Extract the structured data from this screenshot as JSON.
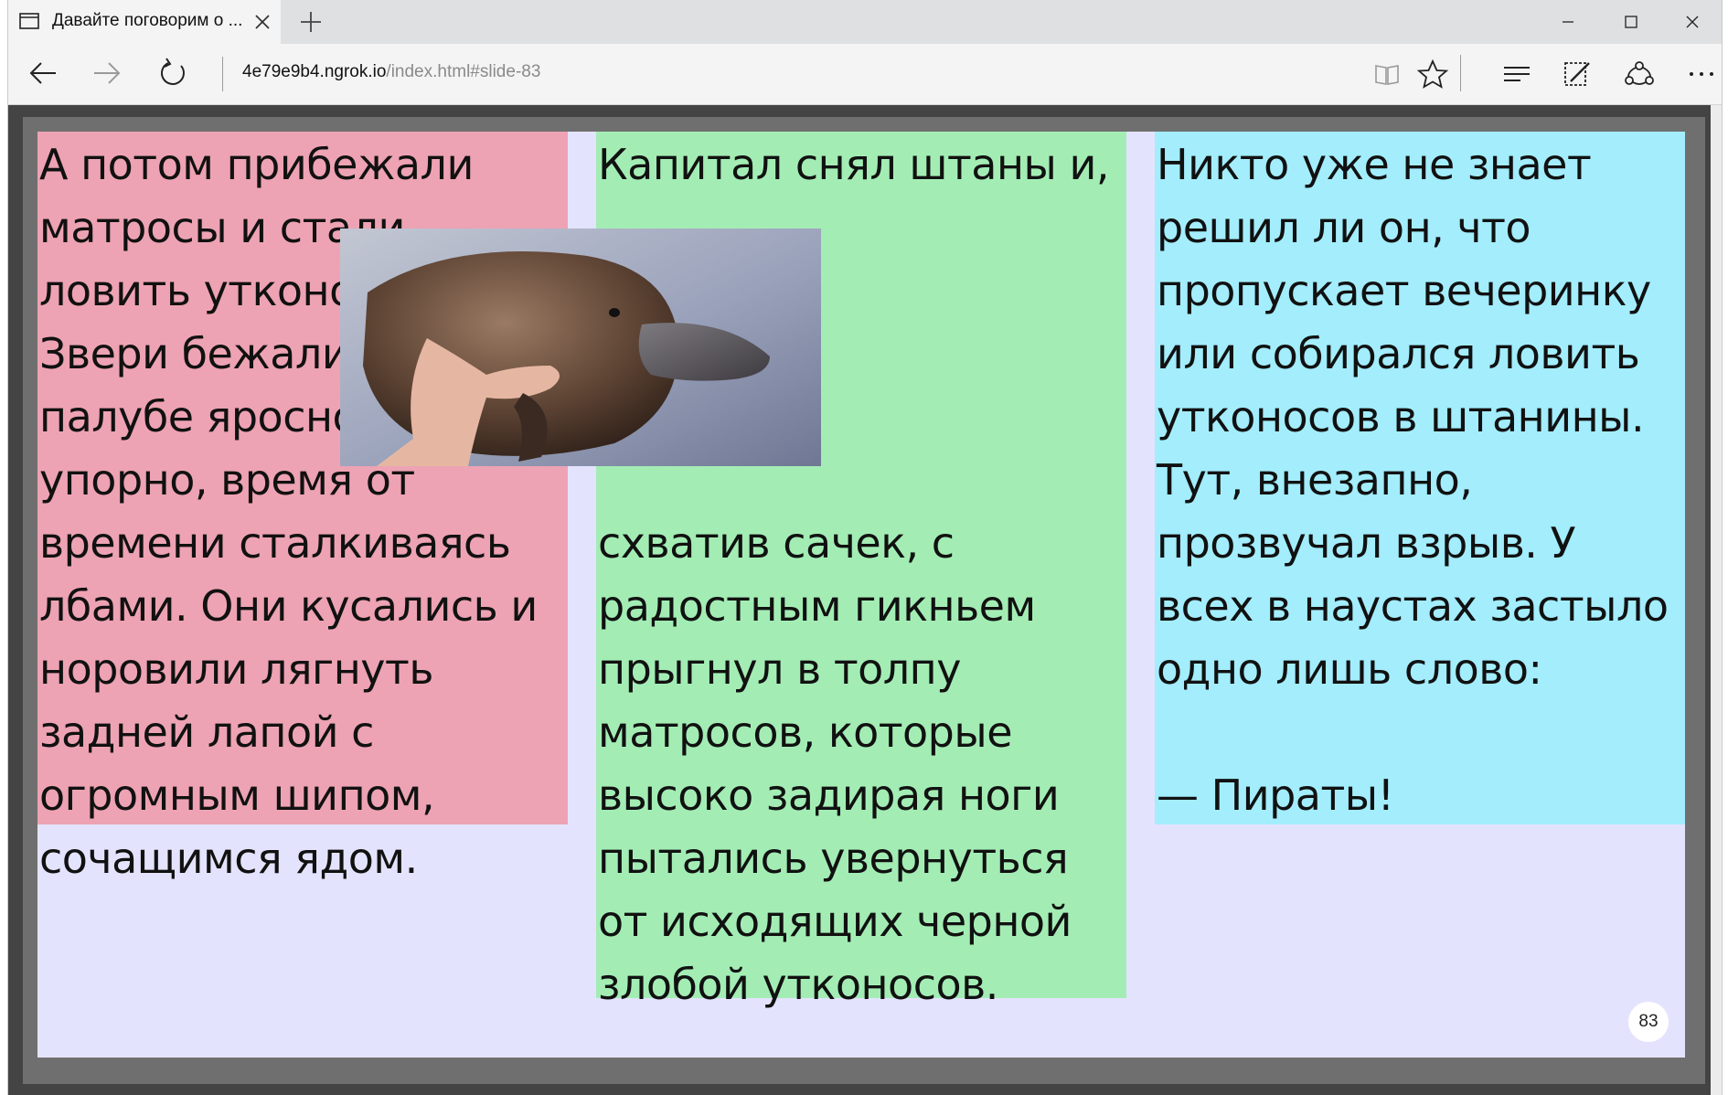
{
  "browser": {
    "tab_title": "Давайте поговорим о ...",
    "address_host": "4e79e9b4.ngrok.io",
    "address_path": "/index.html#slide-83"
  },
  "slide": {
    "column1": "А потом прибежали матросы и стали ловить утконосов. Звери бежали по палубе яросно и упорно, время от времени сталкиваясь лбами. Они кусались и норовили лягнуть задней лапой с огромным шипом, сочащимся ядом.",
    "column2_top": "Капитал снял штаны и,",
    "column2_bottom": "схватив сачек, с радостным гикньем прыгнул в толпу матросов, которые высоко задирая ноги пытались увернуться от исходящих черной злобой утконосов.",
    "column3_main": "Никто уже не знает решил ли он, что пропускает вечеринку или собирался ловить утконосов в штанины. Тут, внезапно, прозвучал взрыв. У всех в наустах застыло одно лишь слово:",
    "column3_exclaim": "— Пираты!",
    "number": "83",
    "colors": {
      "column1": "#eda3b3",
      "column2": "#a3edb5",
      "column3": "#a3edfd",
      "background": "#e4e3fe"
    }
  }
}
